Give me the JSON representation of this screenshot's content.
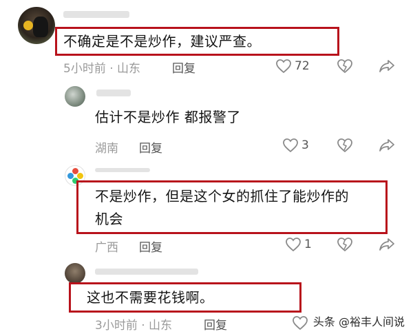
{
  "comments": [
    {
      "text": "不确定是不是炒作，建议严查。",
      "time": "5小时前",
      "location": "山东",
      "reply_label": "回复",
      "likes": "72"
    },
    {
      "text": "估计不是炒作 都报警了",
      "time": "",
      "location": "湖南",
      "reply_label": "回复",
      "likes": "3"
    },
    {
      "text_line1": "不是炒作，但是这个女的抓住了能炒作的",
      "text_line2": "机会",
      "time": "",
      "location": "广西",
      "reply_label": "回复",
      "likes": "1"
    },
    {
      "text": "这也不需要花钱啊。",
      "time": "3小时前",
      "location": "山东",
      "reply_label": "回复",
      "likes": ""
    }
  ],
  "meta_separator": "·",
  "watermark": "头条 @裕丰人间说",
  "colors": {
    "highlight_box": "#b8121b",
    "meta_text": "#9a9a9a",
    "icon": "#8a8a8a"
  },
  "icons": [
    "heart-icon",
    "dislike-icon",
    "share-icon"
  ]
}
